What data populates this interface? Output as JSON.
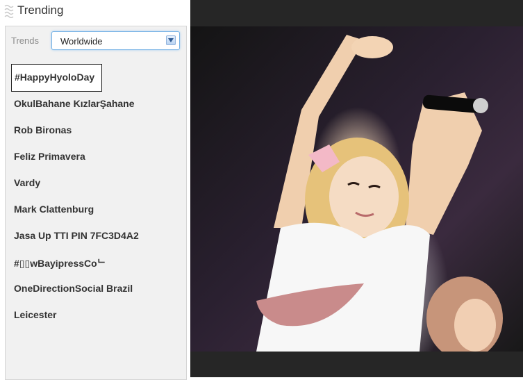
{
  "header": {
    "title": "Trending",
    "icon": "grip-icon"
  },
  "trends_panel": {
    "label": "Trends",
    "location": "Worldwide",
    "items": [
      {
        "text": "#HappyHyoloDay",
        "selected": true
      },
      {
        "text": "OkulBahane KızlarŞahane",
        "selected": false
      },
      {
        "text": "Rob Bironas",
        "selected": false
      },
      {
        "text": "Feliz Primavera",
        "selected": false
      },
      {
        "text": "Vardy",
        "selected": false
      },
      {
        "text": "Mark Clattenburg",
        "selected": false
      },
      {
        "text": "Jasa Up TTI PIN 7FC3D4A2",
        "selected": false
      },
      {
        "text": "#▯▯wBayipressCoᄂ",
        "selected": false
      },
      {
        "text": "OneDirectionSocial Brazil",
        "selected": false
      },
      {
        "text": "Leicester",
        "selected": false
      }
    ]
  },
  "photo": {
    "description_icon": "photo-image"
  },
  "colors": {
    "panel_bg": "#f1f1f1",
    "select_border": "#79b4e6",
    "photo_bg": "#262626",
    "text": "#333333"
  }
}
